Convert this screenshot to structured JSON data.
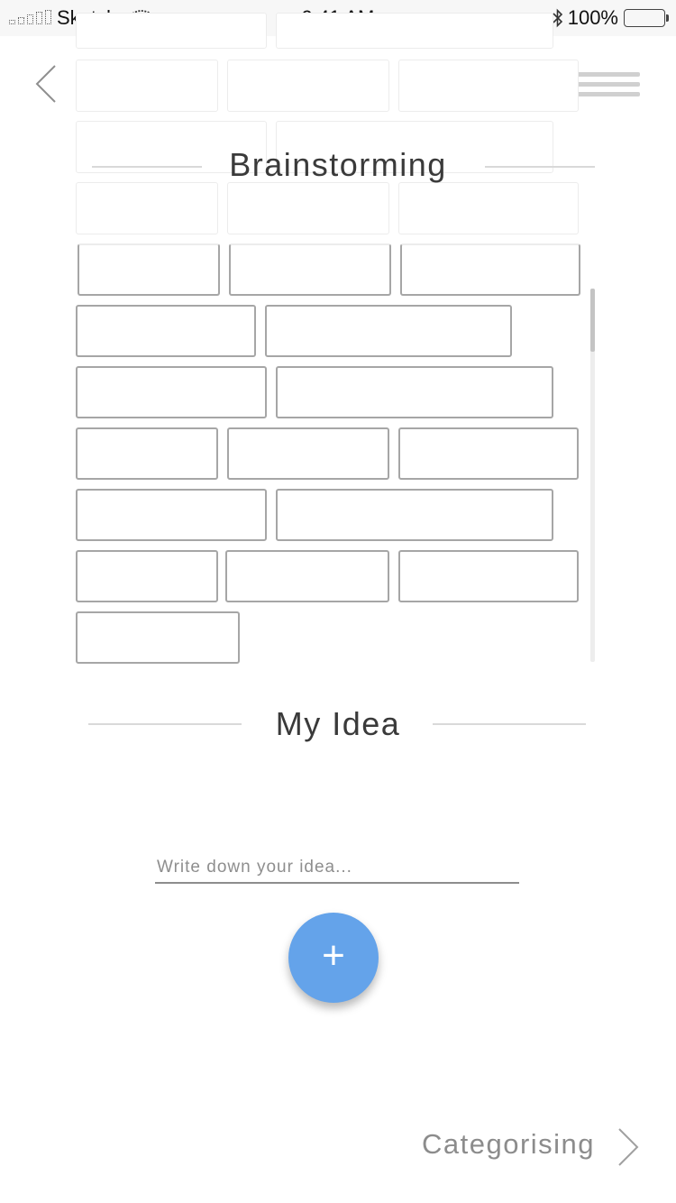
{
  "status_bar": {
    "carrier": "Sketch",
    "time": "9:41 AM",
    "battery": "100%"
  },
  "header": {
    "back_icon": "chevron-left-icon",
    "menu_icon": "hamburger-menu-icon"
  },
  "brainstorming": {
    "title": "Brainstorming"
  },
  "my_idea": {
    "title": "My Idea",
    "input_placeholder": "Write down your idea...",
    "input_value": "",
    "add_icon": "plus-icon",
    "add_label": "+"
  },
  "footer": {
    "next_label": "Categorising",
    "next_icon": "chevron-right-icon"
  },
  "colors": {
    "accent": "#64a3ea",
    "brick_border": "#a6a6a6",
    "text": "#3a3a3a"
  }
}
